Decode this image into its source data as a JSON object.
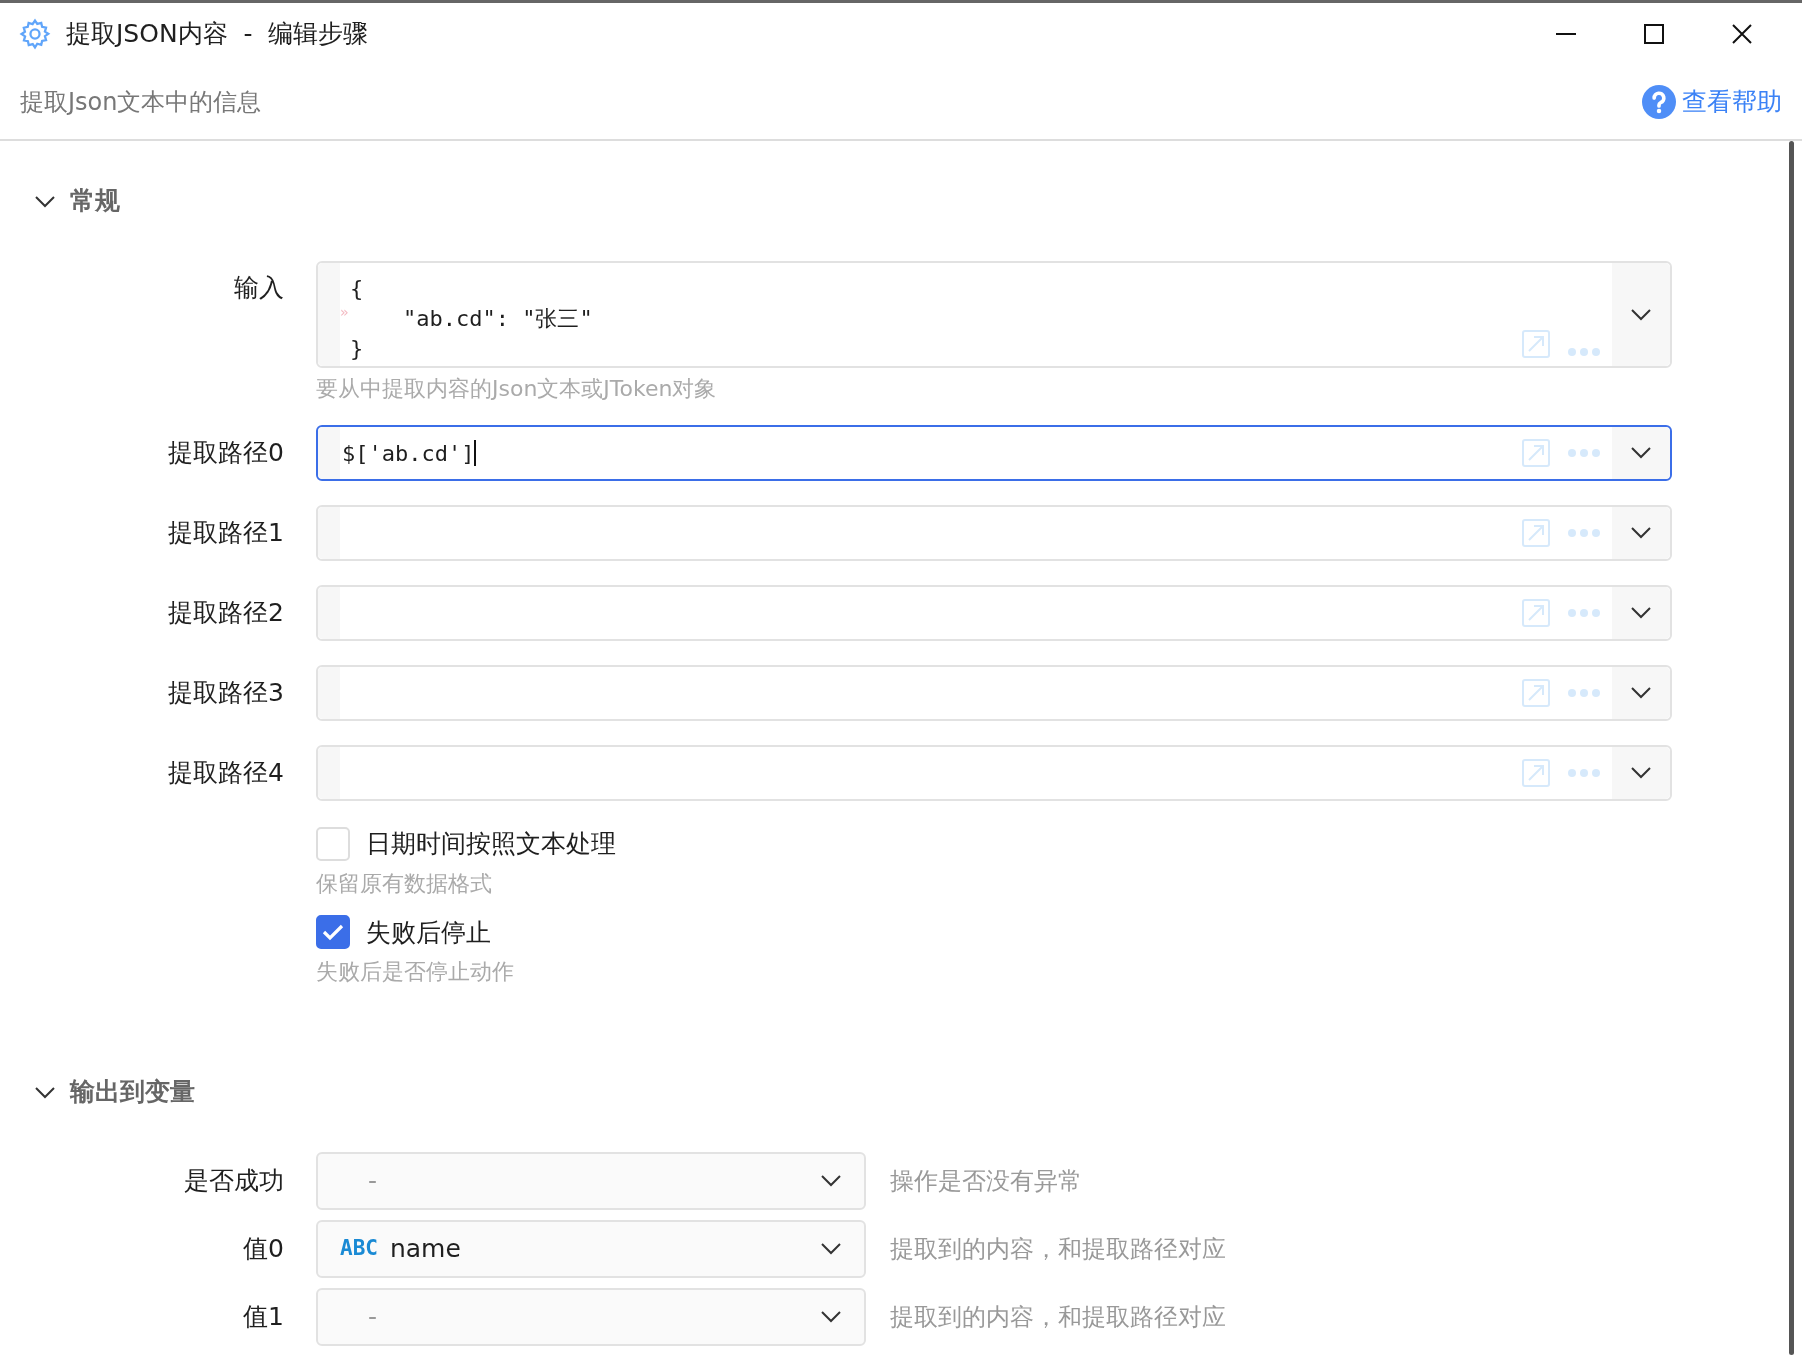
{
  "window": {
    "title": "提取JSON内容  -  编辑步骤",
    "subtitle": "提取Json文本中的信息",
    "help_link": "查看帮助"
  },
  "sections": [
    {
      "title": "常规",
      "expanded": true,
      "fields": [
        {
          "kind": "code",
          "label": "输入",
          "lines": [
            {
              "text": "{"
            },
            {
              "marker": "»",
              "text": "    \"ab.cd\": \"张三\""
            },
            {
              "text": "}"
            }
          ],
          "hint": "要从中提取内容的Json文本或JToken对象"
        },
        {
          "kind": "path",
          "label": "提取路径0",
          "value": "$['ab.cd']",
          "focused": true
        },
        {
          "kind": "path",
          "label": "提取路径1",
          "focused": false
        },
        {
          "kind": "path",
          "label": "提取路径2",
          "focused": false
        },
        {
          "kind": "path",
          "label": "提取路径3",
          "focused": false
        },
        {
          "kind": "path",
          "label": "提取路径4",
          "focused": false
        },
        {
          "kind": "checkbox",
          "label": "日期时间按照文本处理",
          "checked": false,
          "hint": "保留原有数据格式"
        },
        {
          "kind": "checkbox",
          "label": "失败后停止",
          "checked": true,
          "hint": "失败后是否停止动作"
        }
      ]
    },
    {
      "title": "输出到变量",
      "expanded": true,
      "fields": [
        {
          "kind": "output",
          "label": "是否成功",
          "placeholder": "-",
          "description": "操作是否没有异常"
        },
        {
          "kind": "output",
          "label": "值0",
          "value": "name",
          "type_tag": "ABC",
          "description": "提取到的内容，和提取路径对应"
        },
        {
          "kind": "output",
          "label": "值1",
          "placeholder": "-",
          "description": "提取到的内容，和提取路径对应"
        }
      ]
    }
  ]
}
